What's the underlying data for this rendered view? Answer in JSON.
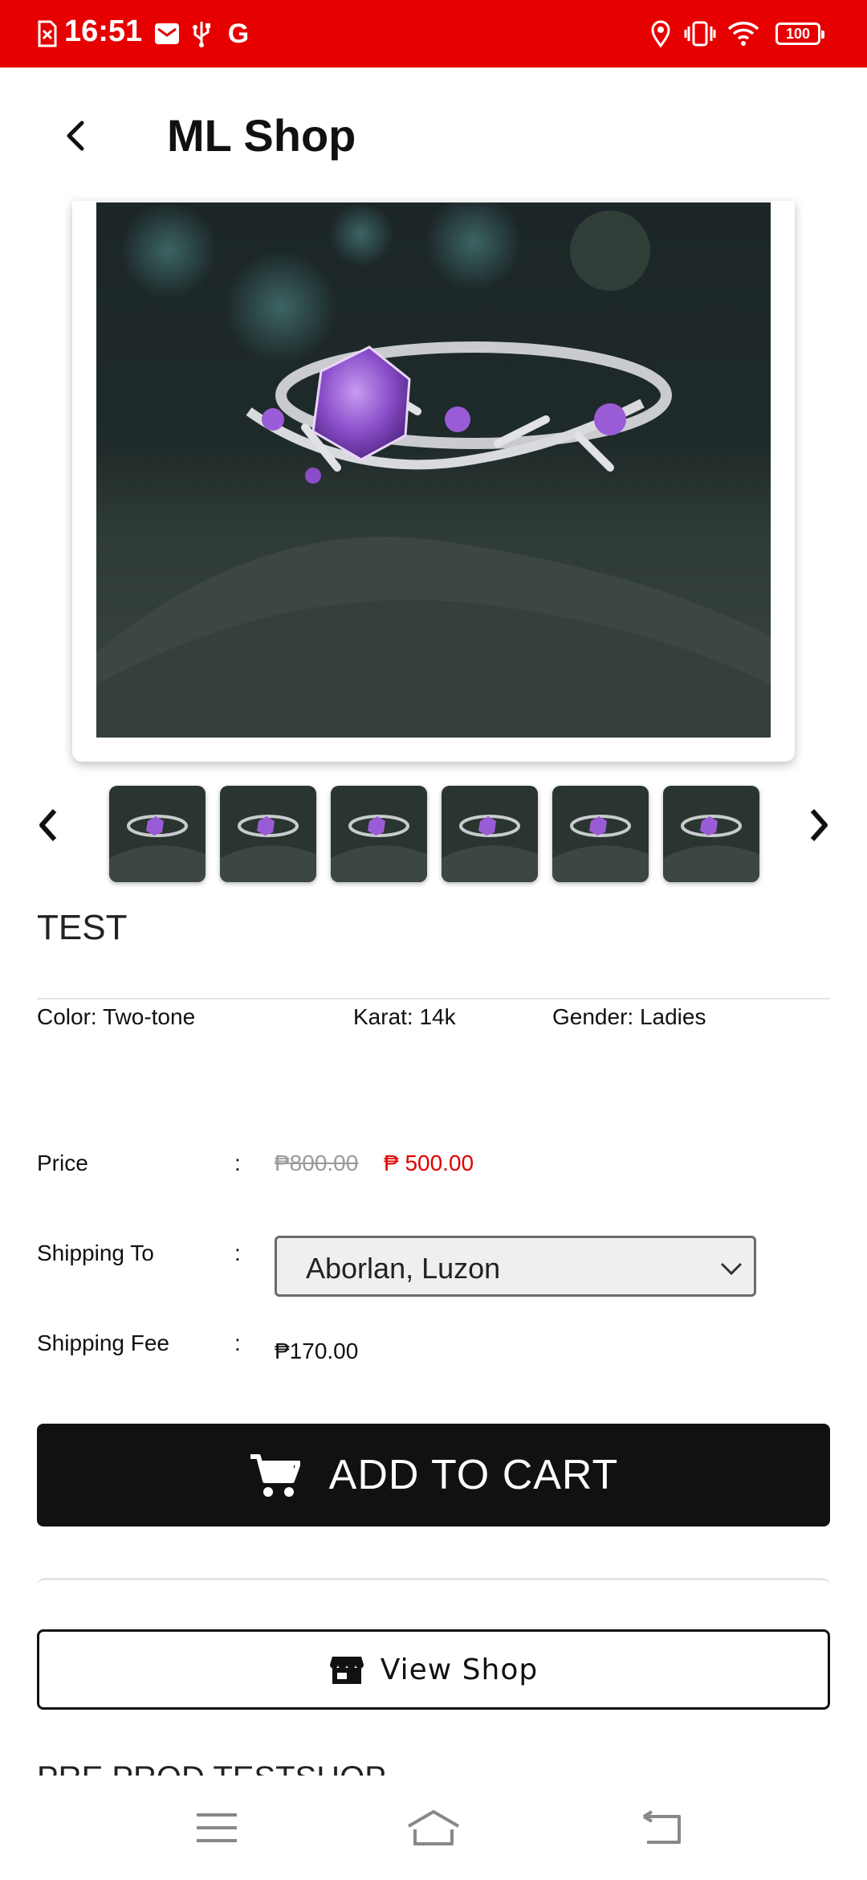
{
  "status_bar": {
    "time": "16:51",
    "battery": "100",
    "left_icons": [
      "sim-error-icon",
      "mail-icon",
      "usb-icon",
      "google-icon"
    ],
    "right_icons": [
      "location-icon",
      "vibrate-icon",
      "wifi-icon",
      "battery-icon"
    ]
  },
  "app_bar": {
    "title": "ML Shop",
    "back_icon": "back-arrow-icon"
  },
  "product": {
    "name": "TEST",
    "attributes": {
      "color": "Color: Two-tone",
      "karat": "Karat: 14k",
      "gender": "Gender: Ladies"
    },
    "thumbnail_count": 6
  },
  "details": {
    "price_label": "Price",
    "colon": ":",
    "old_price": "₱800.00",
    "new_price": "₱ 500.00",
    "shipping_to_label": "Shipping To",
    "shipping_to_value": "Aborlan, Luzon",
    "shipping_fee_label": "Shipping Fee",
    "shipping_fee_value": "₱170.00"
  },
  "actions": {
    "add_to_cart": "ADD TO CART",
    "view_shop": "View Shop"
  },
  "shop": {
    "name": "PRE PROD TESTSHOP"
  },
  "colors": {
    "status_bar": "#e60000",
    "sale_price": "#e00000",
    "button_dark": "#111111"
  }
}
